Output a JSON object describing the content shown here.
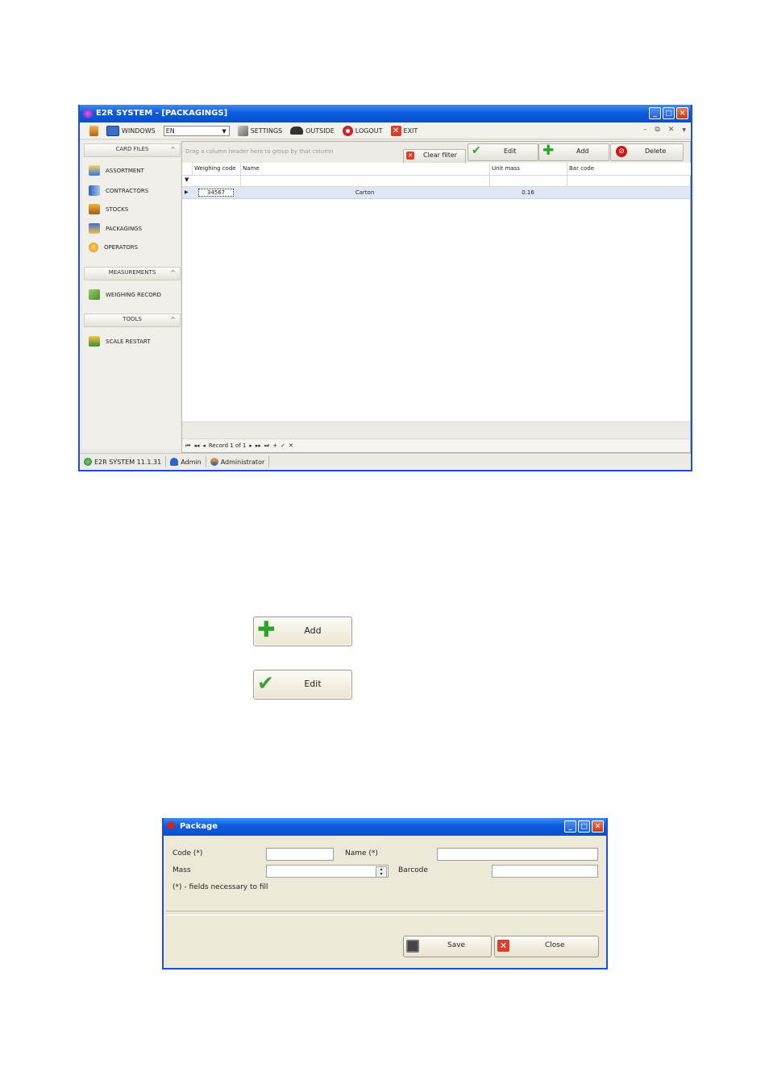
{
  "main_window": {
    "title": "E2R SYSTEM - [PACKAGINGS]",
    "toolbar": {
      "windows": "WINDOWS",
      "language": "EN",
      "settings": "SETTINGS",
      "outside": "OUTSIDE",
      "logout": "LOGOUT",
      "exit": "EXIT"
    },
    "sidebar": {
      "card_files": "CARD FILES",
      "card_items": [
        "ASSORTMENT",
        "CONTRACTORS",
        "STOCKS",
        "PACKAGINGS",
        "OPERATORS"
      ],
      "measurements": "MEASUREMENTS",
      "measurement_items": [
        "WEIGHING RECORD"
      ],
      "tools": "TOOLS",
      "tool_items": [
        "SCALE RESTART"
      ]
    },
    "grid": {
      "group_hint": "Drag a column header here to group by that column",
      "clear_filter": "Clear filter",
      "edit": "Edit",
      "add": "Add",
      "delete": "Delete",
      "columns": [
        "Weighing code",
        "Name",
        "Unit mass",
        "Bar code"
      ],
      "rows": [
        {
          "weighing_code": "34567",
          "name": "Carton",
          "unit_mass": "0.16",
          "bar_code": ""
        }
      ],
      "record_nav": "Record 1 of 1"
    },
    "status": {
      "version": "E2R SYSTEM 11.1.31",
      "user": "Admin",
      "role": "Administrator"
    }
  },
  "buttons": {
    "add": "Add",
    "edit": "Edit"
  },
  "package_dialog": {
    "title": "Package",
    "code_label": "Code (*)",
    "name_label": "Name (*)",
    "mass_label": "Mass",
    "barcode_label": "Barcode",
    "note": "(*) - fields necessary to fill",
    "save": "Save",
    "close": "Close"
  },
  "colors": {
    "titlebar": "#0b5ce0",
    "selected_row": "#dfe7f5",
    "add_icon": "#2aa52a",
    "delete_icon": "#d01818"
  }
}
